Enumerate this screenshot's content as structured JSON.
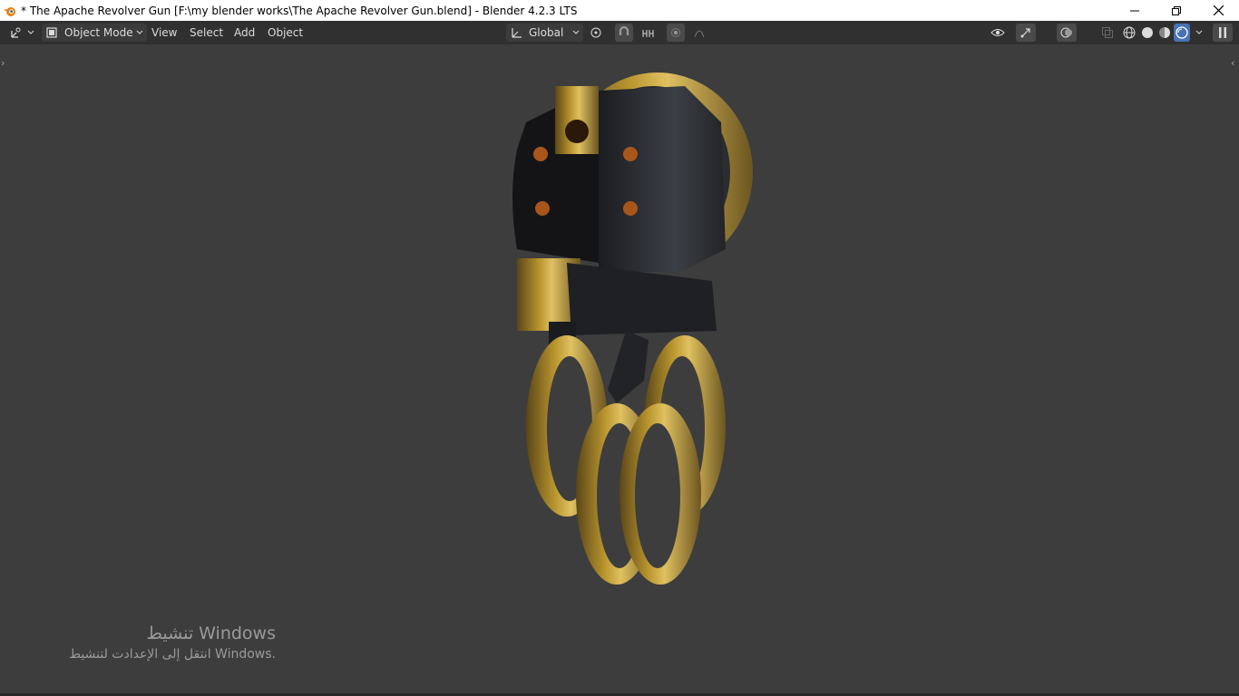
{
  "window": {
    "title": "* The Apache Revolver Gun [F:\\my blender works\\The Apache Revolver Gun.blend] - Blender 4.2.3 LTS",
    "app_icon": "blender-logo-icon",
    "controls": [
      "minimize-icon",
      "restore-icon",
      "close-icon"
    ]
  },
  "header": {
    "editor_type_icon": "3d-viewport-icon",
    "mode": "Object Mode",
    "menus": [
      "View",
      "Select",
      "Add",
      "Object"
    ],
    "transform_orientation": "Global",
    "tool_icons": [
      "transform-pivot-icon",
      "snap-magnet-icon",
      "snap-increment-icon",
      "proportional-editing-icon",
      "falloff-curve-icon"
    ],
    "right_icons": [
      "visibility-eye-icon",
      "gizmo-icon",
      "overlay-icon",
      "xray-icon",
      "wireframe-shading-icon",
      "solid-shading-icon",
      "material-preview-icon",
      "rendered-shading-icon",
      "pause-icon"
    ],
    "active_shading": "rendered"
  },
  "viewport": {
    "background": "#3d3d3d",
    "object": "revolver-gun-model"
  },
  "watermark": {
    "line1": "تنشيط Windows",
    "line2": "انتقل إلى الإعدادت لتنشيط Windows."
  }
}
